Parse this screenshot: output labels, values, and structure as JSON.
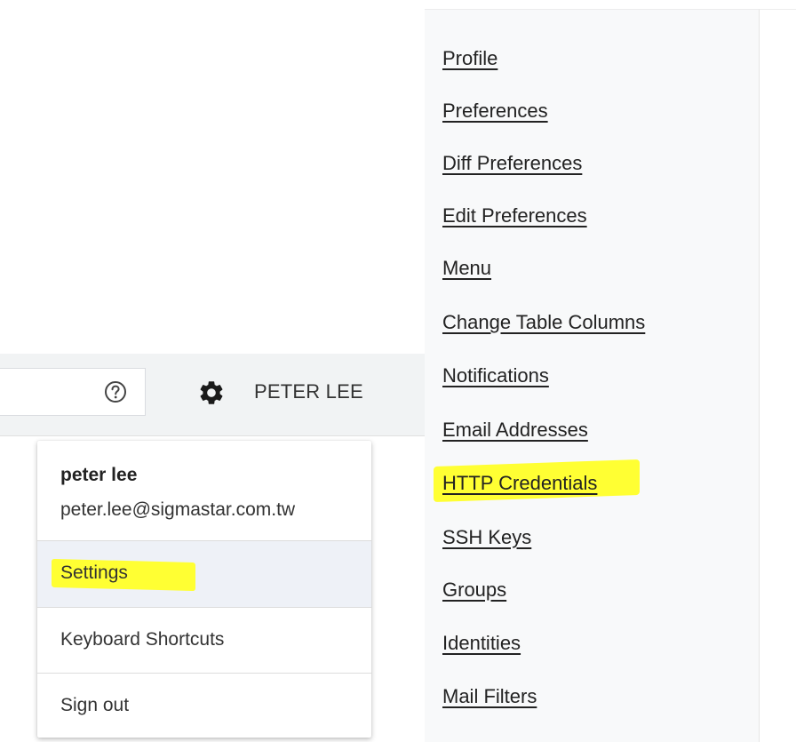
{
  "header": {
    "user_name_label": "PETER LEE",
    "help_icon": "help-circle-icon",
    "settings_icon": "gear-icon"
  },
  "account_dropdown": {
    "name": "peter lee",
    "email": "peter.lee@sigmastar.com.tw",
    "items": [
      {
        "label": "Settings",
        "highlighted": true
      },
      {
        "label": "Keyboard Shortcuts"
      },
      {
        "label": "Sign out"
      }
    ]
  },
  "settings_nav": {
    "items": [
      {
        "label": "Profile"
      },
      {
        "label": "Preferences"
      },
      {
        "label": "Diff Preferences"
      },
      {
        "label": "Edit Preferences"
      },
      {
        "label": "Menu"
      },
      {
        "label": "Change Table Columns"
      },
      {
        "label": "Notifications"
      },
      {
        "label": "Email Addresses"
      },
      {
        "label": "HTTP Credentials",
        "highlighted": true
      },
      {
        "label": "SSH Keys"
      },
      {
        "label": "Groups"
      },
      {
        "label": "Identities"
      },
      {
        "label": "Mail Filters"
      }
    ]
  },
  "colors": {
    "highlight": "#ffff33",
    "header_bg": "#f1f3f4",
    "nav_bg": "#f8f9fa",
    "selected_item_bg": "#eef1f7"
  }
}
